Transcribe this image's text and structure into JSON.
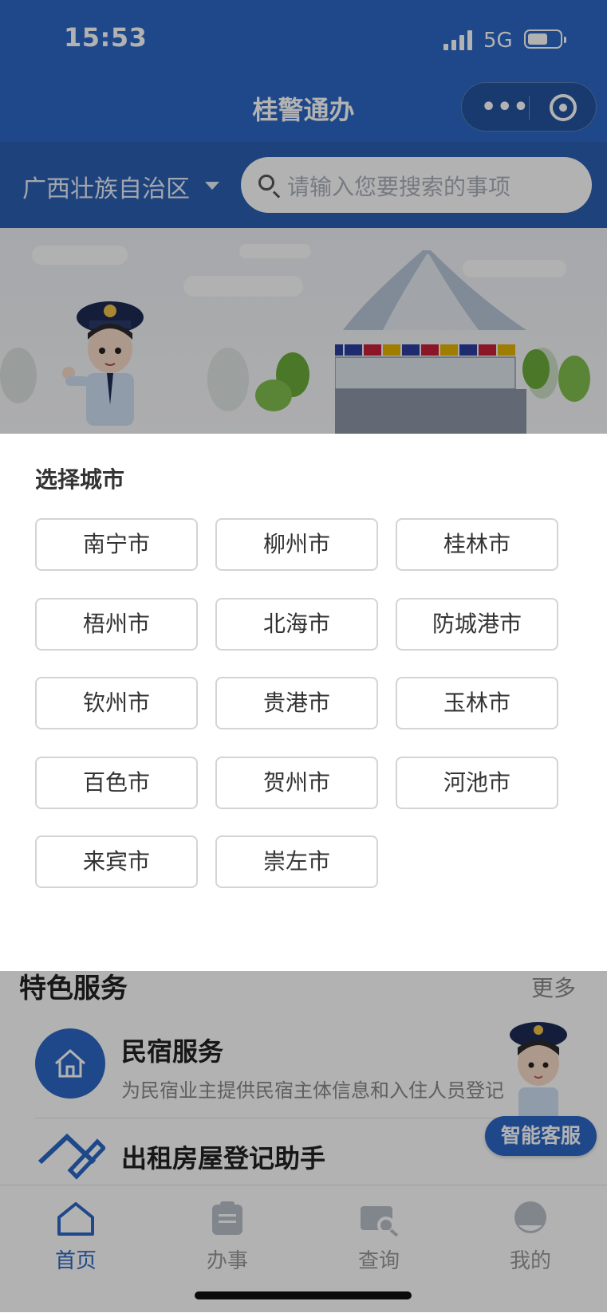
{
  "status_bar": {
    "time": "15:53",
    "network": "5G",
    "battery_percent": 55
  },
  "nav": {
    "title": "桂警通办",
    "more_icon": "more-dots-icon",
    "close_icon": "target-icon"
  },
  "header": {
    "region": "广西壮族自治区",
    "search_placeholder": "请输入您要搜索的事项"
  },
  "city_picker": {
    "title": "选择城市",
    "cities": [
      "南宁市",
      "柳州市",
      "桂林市",
      "梧州市",
      "北海市",
      "防城港市",
      "钦州市",
      "贵港市",
      "玉林市",
      "百色市",
      "贺州市",
      "河池市",
      "来宾市",
      "崇左市"
    ]
  },
  "services": {
    "section_title": "特色服务",
    "more": "更多",
    "items": [
      {
        "title": "民宿服务",
        "desc": "为民宿业主提供民宿主体信息和入住人员登记",
        "icon": "house-icon"
      },
      {
        "title": "出租房屋登记助手",
        "icon": "house-edit-icon"
      }
    ]
  },
  "assistant": {
    "label": "智能客服"
  },
  "tabbar": {
    "tabs": [
      {
        "label": "首页",
        "icon": "home-icon",
        "active": true
      },
      {
        "label": "办事",
        "icon": "clipboard-icon",
        "active": false
      },
      {
        "label": "查询",
        "icon": "search-card-icon",
        "active": false
      },
      {
        "label": "我的",
        "icon": "user-icon",
        "active": false
      }
    ]
  },
  "colors": {
    "primary": "#2b67c4",
    "header_dark": "#2a5fb2"
  }
}
